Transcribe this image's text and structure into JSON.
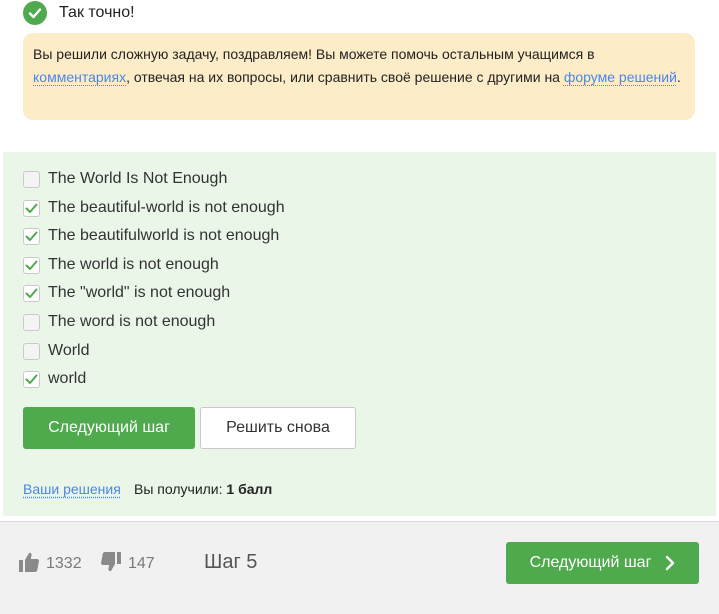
{
  "result": {
    "title": "Так точно!",
    "message_part1": "Вы решили сложную задачу, поздравляем! Вы можете помочь остальным учащимся в ",
    "comments_link": "комментариях",
    "message_part2": ", отвечая на их вопросы, или сравнить своё решение с другими на ",
    "forum_link": "форуме решений",
    "message_part3": "."
  },
  "options": [
    {
      "label": "The World Is Not Enough",
      "checked": false
    },
    {
      "label": "The beautiful-world is not enough",
      "checked": true
    },
    {
      "label": "The beautifulworld is not enough",
      "checked": true
    },
    {
      "label": "The world is not enough",
      "checked": true
    },
    {
      "label": "The \"world\" is not enough",
      "checked": true
    },
    {
      "label": "The word is not enough",
      "checked": false
    },
    {
      "label": "World",
      "checked": false
    },
    {
      "label": "world",
      "checked": true
    }
  ],
  "actions": {
    "next_label": "Следующий шаг",
    "retry_label": "Решить снова"
  },
  "summary": {
    "your_solutions": "Ваши решения",
    "score_prefix": "Вы получили: ",
    "score_value": "1 балл"
  },
  "footer": {
    "likes": "1332",
    "dislikes": "147",
    "step": "Шаг 5",
    "next_label": "Следующий шаг"
  },
  "colors": {
    "accent_green": "#4fa94d",
    "link_blue": "#4a86e8",
    "info_bg": "#fdecc8",
    "answers_bg": "#e9f6e8"
  }
}
